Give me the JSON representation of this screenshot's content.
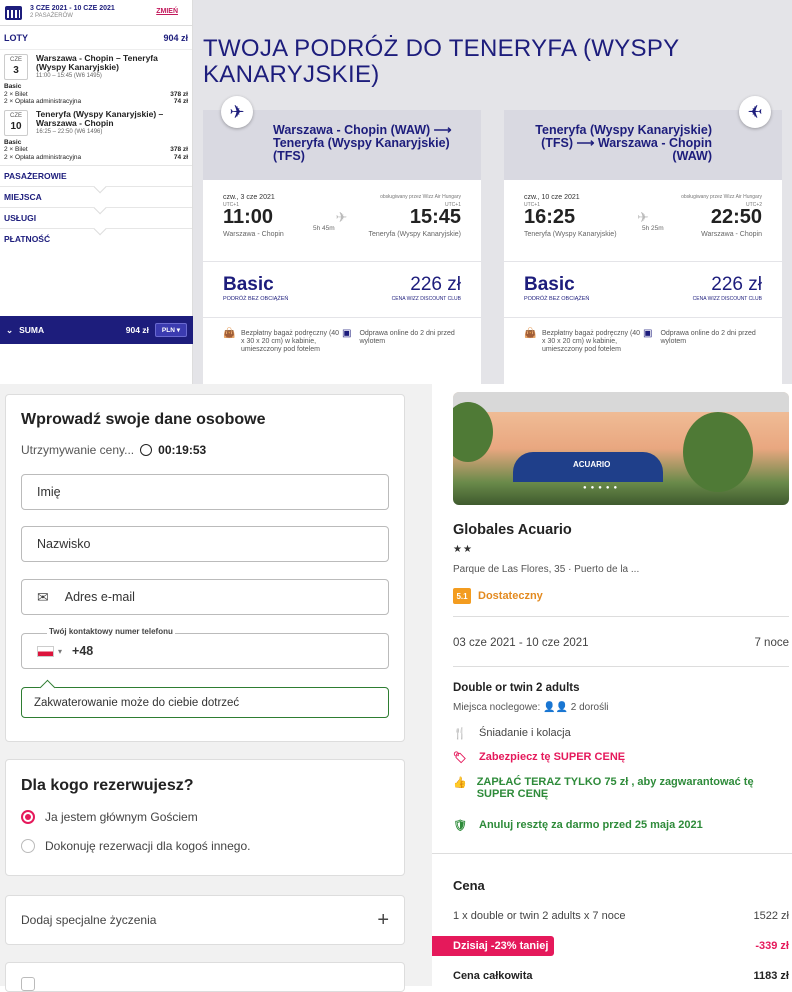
{
  "sidebar": {
    "dates": "3 CZE 2021 - 10 CZE 2021",
    "passengers": "2 PASAŻERÓW",
    "change": "ZMIEŃ",
    "flights_label": "LOTY",
    "flights_total": "904 zł",
    "flights": [
      {
        "month": "CZE",
        "day": "3",
        "route": "Warszawa - Chopin – Teneryfa (Wyspy Kanaryjskie)",
        "time": "11:00 – 15:45 (W6 1495)",
        "fare": "Basic",
        "ticket": "2 × Bilet",
        "ticket_price": "378 zł",
        "fee": "2 × Opłata administracyjna",
        "fee_price": "74 zł"
      },
      {
        "month": "CZE",
        "day": "10",
        "route": "Teneryfa (Wyspy Kanaryjskie) – Warszawa - Chopin",
        "time": "16:25 – 22:50 (W6 1496)",
        "fare": "Basic",
        "ticket": "2 × Bilet",
        "ticket_price": "378 zł",
        "fee": "2 × Opłata administracyjna",
        "fee_price": "74 zł"
      }
    ],
    "sections": [
      "PASAŻEROWIE",
      "MIEJSCA",
      "USŁUGI",
      "PŁATNOŚĆ"
    ],
    "sum_label": "SUMA",
    "sum_value": "904 zł",
    "currency": "PLN"
  },
  "wizz": {
    "title": "TWOJA PODRÓŻ DO TENERYFA (WYSPY KANARYJSKIE)",
    "cards": [
      {
        "route": "Warszawa - Chopin (WAW) ⟶ Teneryfa (Wyspy Kanaryjskie) (TFS)",
        "date": "czw., 3 cze 2021",
        "operator": "obsługiwany przez Wizz Air Hungary",
        "utc_dep": "UTC+1",
        "utc_arr": "UTC+1",
        "dep": "11:00",
        "arr": "15:45",
        "duration": "5h 45m",
        "from": "Warszawa - Chopin",
        "to": "Teneryfa (Wyspy Kanaryjskie)",
        "fare": "Basic",
        "fare_sub": "PODRÓŻ BEZ OBCIĄŻEŃ",
        "price": "226 zł",
        "price_sub": "CENA WIZZ DISCOUNT CLUB",
        "perk1": "Bezpłatny bagaż podręczny (40 x 30 x 20 cm) w kabinie, umieszczony pod fotelem",
        "perk2": "Odprawa online do 2 dni przed wylotem"
      },
      {
        "route": "Teneryfa (Wyspy Kanaryjskie) (TFS) ⟶ Warszawa - Chopin (WAW)",
        "date": "czw., 10 cze 2021",
        "operator": "obsługiwany przez Wizz Air Hungary",
        "utc_dep": "UTC+1",
        "utc_arr": "UTC+2",
        "dep": "16:25",
        "arr": "22:50",
        "duration": "5h 25m",
        "from": "Teneryfa (Wyspy Kanaryjskie)",
        "to": "Warszawa - Chopin",
        "fare": "Basic",
        "fare_sub": "PODRÓŻ BEZ OBCIĄŻEŃ",
        "price": "226 zł",
        "price_sub": "CENA WIZZ DISCOUNT CLUB",
        "perk1": "Bezpłatny bagaż podręczny (40 x 30 x 20 cm) w kabinie, umieszczony pod fotelem",
        "perk2": "Odprawa online do 2 dni przed wylotem"
      }
    ]
  },
  "form": {
    "title": "Wprowadź swoje dane osobowe",
    "hold_label": "Utrzymywanie ceny...",
    "hold_time": "00:19:53",
    "first_name_placeholder": "Imię",
    "last_name_placeholder": "Nazwisko",
    "email_placeholder": "Adres e-mail",
    "phone_label": "Twój kontaktowy numer telefonu",
    "phone_prefix": "+48",
    "hint": "Zakwaterowanie może do ciebie dotrzeć",
    "who_title": "Dla kogo rezerwujesz?",
    "opt1": "Ja jestem głównym Gościem",
    "opt2": "Dokonuję rezerwacji dla kogoś innego.",
    "special": "Dodaj specjalne życzenia"
  },
  "hotel": {
    "name": "Globales Acuario",
    "stars": "★★",
    "address": "Parque de Las Flores, 35 · Puerto de la ...",
    "score": "5.1",
    "score_label": "Dostateczny",
    "dates": "03 cze 2021 - 10 cze 2021",
    "nights": "7 noce",
    "room": "Double or twin 2 adults",
    "sleeps_label": "Miejsca noclegowe:",
    "sleeps_value": "2 dorośli",
    "meal": "Śniadanie i kolacja",
    "super": "Zabezpiecz tę SUPER CENĘ",
    "pay_now": "ZAPŁAĆ TERAZ TYLKO 75 zł , aby zagwarantować tę SUPER CENĘ",
    "cancel": "Anuluj resztę za darmo przed 25 maja 2021",
    "price_title": "Cena",
    "line1": "1 x double or twin 2 adults x 7 noce",
    "line1_val": "1522 zł",
    "discount_label": "Dzisiaj -23% taniej",
    "discount_val": "-339 zł",
    "total_label": "Cena całkowita",
    "total_val": "1183 zł",
    "photo_label": "ACUARIO"
  }
}
